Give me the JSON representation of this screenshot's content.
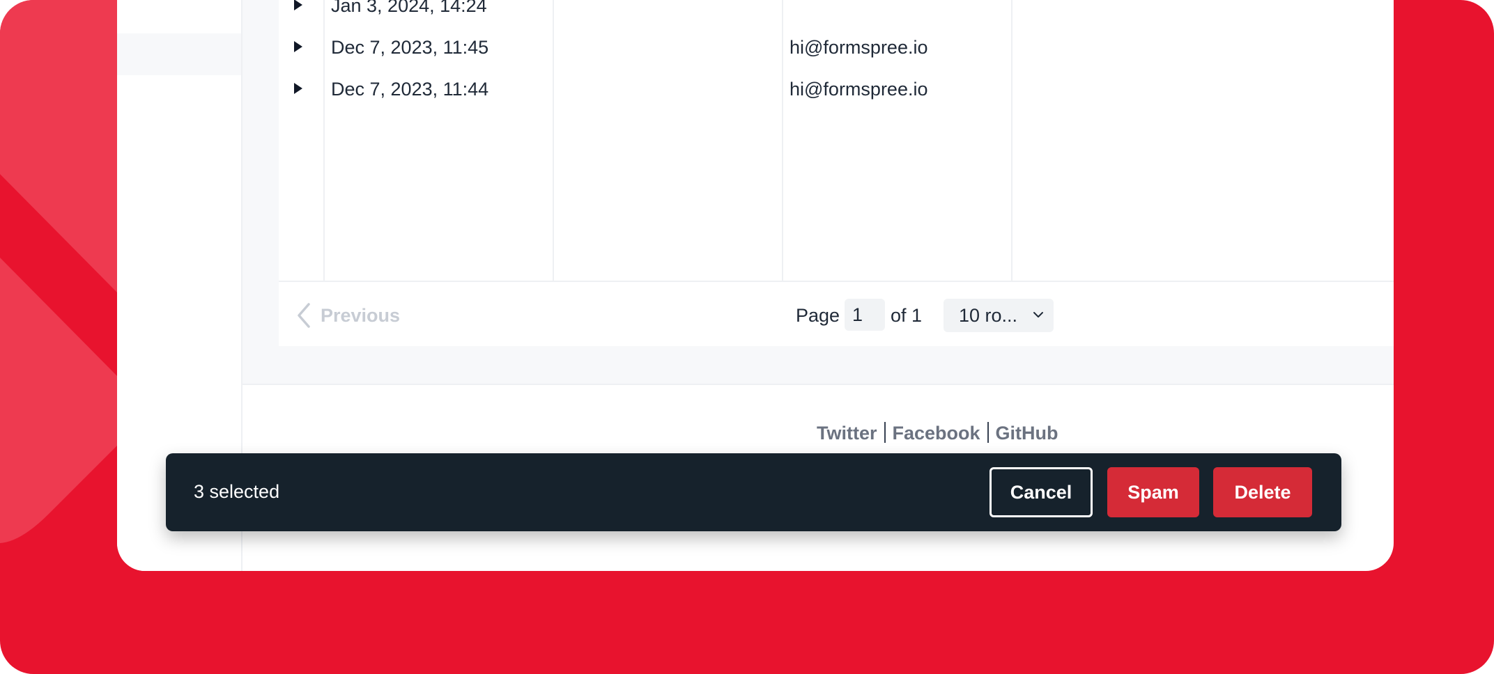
{
  "colors": {
    "brand_red": "#e8132e",
    "action_bar_bg": "#16222c",
    "danger_button": "#d52b37"
  },
  "table": {
    "rows": [
      {
        "date": "Jan 3, 2024, 14:24",
        "email": ""
      },
      {
        "date": "Dec 7, 2023, 11:45",
        "email": "hi@formspree.io"
      },
      {
        "date": "Dec 7, 2023, 11:44",
        "email": "hi@formspree.io"
      }
    ]
  },
  "pagination": {
    "previous_label": "Previous",
    "page_label": "Page",
    "current_page": "1",
    "of_label": "of 1",
    "rows_per_page": "10 ro..."
  },
  "footer": {
    "links": [
      "Twitter",
      "Facebook",
      "GitHub"
    ]
  },
  "action_bar": {
    "selected_text": "3 selected",
    "cancel_label": "Cancel",
    "spam_label": "Spam",
    "delete_label": "Delete"
  },
  "icons": {
    "previous": "chevron-left-icon",
    "dropdown": "chevron-down-icon",
    "row_expand": "triangle-right-icon"
  }
}
